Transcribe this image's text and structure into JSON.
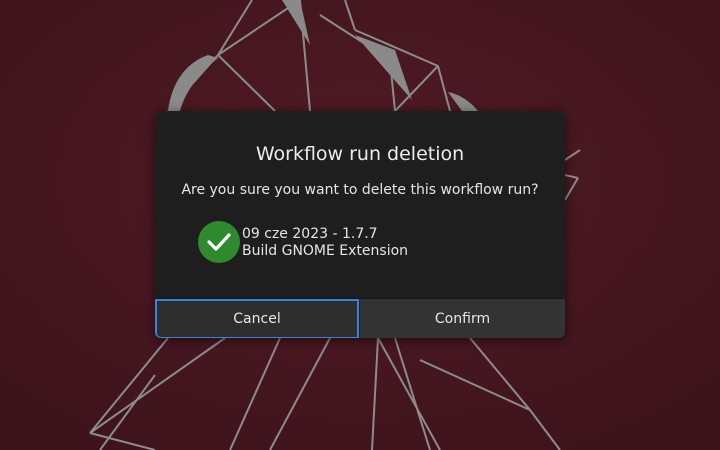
{
  "dialog": {
    "title": "Workflow run deletion",
    "question": "Are you sure you want to delete this workflow run?",
    "run": {
      "status_icon": "success-check-icon",
      "status_color": "#2f8a2f",
      "date_version": "09 cze 2023 - 1.7.7",
      "workflow_name": "Build GNOME Extension"
    },
    "buttons": {
      "cancel_label": "Cancel",
      "confirm_label": "Confirm"
    },
    "focus_color": "#3584e4"
  },
  "wallpaper": {
    "background_color": "#4a1a22",
    "line_color": "#8a8a8a"
  }
}
